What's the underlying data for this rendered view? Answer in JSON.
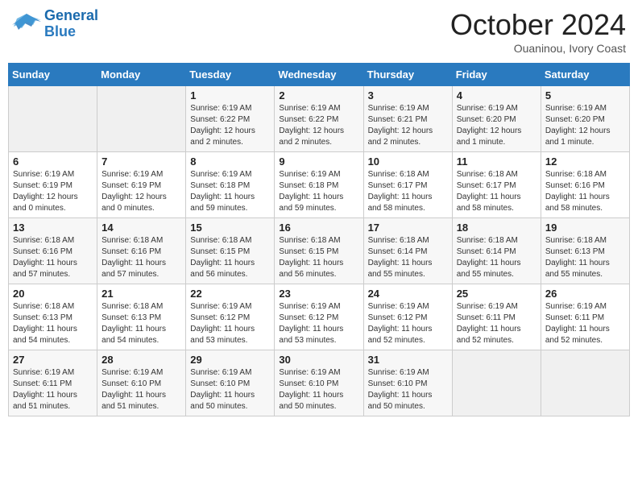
{
  "header": {
    "logo_line1": "General",
    "logo_line2": "Blue",
    "month_title": "October 2024",
    "subtitle": "Ouaninou, Ivory Coast"
  },
  "weekdays": [
    "Sunday",
    "Monday",
    "Tuesday",
    "Wednesday",
    "Thursday",
    "Friday",
    "Saturday"
  ],
  "weeks": [
    [
      {
        "day": "",
        "info": ""
      },
      {
        "day": "",
        "info": ""
      },
      {
        "day": "1",
        "info": "Sunrise: 6:19 AM\nSunset: 6:22 PM\nDaylight: 12 hours and 2 minutes."
      },
      {
        "day": "2",
        "info": "Sunrise: 6:19 AM\nSunset: 6:22 PM\nDaylight: 12 hours and 2 minutes."
      },
      {
        "day": "3",
        "info": "Sunrise: 6:19 AM\nSunset: 6:21 PM\nDaylight: 12 hours and 2 minutes."
      },
      {
        "day": "4",
        "info": "Sunrise: 6:19 AM\nSunset: 6:20 PM\nDaylight: 12 hours and 1 minute."
      },
      {
        "day": "5",
        "info": "Sunrise: 6:19 AM\nSunset: 6:20 PM\nDaylight: 12 hours and 1 minute."
      }
    ],
    [
      {
        "day": "6",
        "info": "Sunrise: 6:19 AM\nSunset: 6:19 PM\nDaylight: 12 hours and 0 minutes."
      },
      {
        "day": "7",
        "info": "Sunrise: 6:19 AM\nSunset: 6:19 PM\nDaylight: 12 hours and 0 minutes."
      },
      {
        "day": "8",
        "info": "Sunrise: 6:19 AM\nSunset: 6:18 PM\nDaylight: 11 hours and 59 minutes."
      },
      {
        "day": "9",
        "info": "Sunrise: 6:19 AM\nSunset: 6:18 PM\nDaylight: 11 hours and 59 minutes."
      },
      {
        "day": "10",
        "info": "Sunrise: 6:18 AM\nSunset: 6:17 PM\nDaylight: 11 hours and 58 minutes."
      },
      {
        "day": "11",
        "info": "Sunrise: 6:18 AM\nSunset: 6:17 PM\nDaylight: 11 hours and 58 minutes."
      },
      {
        "day": "12",
        "info": "Sunrise: 6:18 AM\nSunset: 6:16 PM\nDaylight: 11 hours and 58 minutes."
      }
    ],
    [
      {
        "day": "13",
        "info": "Sunrise: 6:18 AM\nSunset: 6:16 PM\nDaylight: 11 hours and 57 minutes."
      },
      {
        "day": "14",
        "info": "Sunrise: 6:18 AM\nSunset: 6:16 PM\nDaylight: 11 hours and 57 minutes."
      },
      {
        "day": "15",
        "info": "Sunrise: 6:18 AM\nSunset: 6:15 PM\nDaylight: 11 hours and 56 minutes."
      },
      {
        "day": "16",
        "info": "Sunrise: 6:18 AM\nSunset: 6:15 PM\nDaylight: 11 hours and 56 minutes."
      },
      {
        "day": "17",
        "info": "Sunrise: 6:18 AM\nSunset: 6:14 PM\nDaylight: 11 hours and 55 minutes."
      },
      {
        "day": "18",
        "info": "Sunrise: 6:18 AM\nSunset: 6:14 PM\nDaylight: 11 hours and 55 minutes."
      },
      {
        "day": "19",
        "info": "Sunrise: 6:18 AM\nSunset: 6:13 PM\nDaylight: 11 hours and 55 minutes."
      }
    ],
    [
      {
        "day": "20",
        "info": "Sunrise: 6:18 AM\nSunset: 6:13 PM\nDaylight: 11 hours and 54 minutes."
      },
      {
        "day": "21",
        "info": "Sunrise: 6:18 AM\nSunset: 6:13 PM\nDaylight: 11 hours and 54 minutes."
      },
      {
        "day": "22",
        "info": "Sunrise: 6:19 AM\nSunset: 6:12 PM\nDaylight: 11 hours and 53 minutes."
      },
      {
        "day": "23",
        "info": "Sunrise: 6:19 AM\nSunset: 6:12 PM\nDaylight: 11 hours and 53 minutes."
      },
      {
        "day": "24",
        "info": "Sunrise: 6:19 AM\nSunset: 6:12 PM\nDaylight: 11 hours and 52 minutes."
      },
      {
        "day": "25",
        "info": "Sunrise: 6:19 AM\nSunset: 6:11 PM\nDaylight: 11 hours and 52 minutes."
      },
      {
        "day": "26",
        "info": "Sunrise: 6:19 AM\nSunset: 6:11 PM\nDaylight: 11 hours and 52 minutes."
      }
    ],
    [
      {
        "day": "27",
        "info": "Sunrise: 6:19 AM\nSunset: 6:11 PM\nDaylight: 11 hours and 51 minutes."
      },
      {
        "day": "28",
        "info": "Sunrise: 6:19 AM\nSunset: 6:10 PM\nDaylight: 11 hours and 51 minutes."
      },
      {
        "day": "29",
        "info": "Sunrise: 6:19 AM\nSunset: 6:10 PM\nDaylight: 11 hours and 50 minutes."
      },
      {
        "day": "30",
        "info": "Sunrise: 6:19 AM\nSunset: 6:10 PM\nDaylight: 11 hours and 50 minutes."
      },
      {
        "day": "31",
        "info": "Sunrise: 6:19 AM\nSunset: 6:10 PM\nDaylight: 11 hours and 50 minutes."
      },
      {
        "day": "",
        "info": ""
      },
      {
        "day": "",
        "info": ""
      }
    ]
  ]
}
